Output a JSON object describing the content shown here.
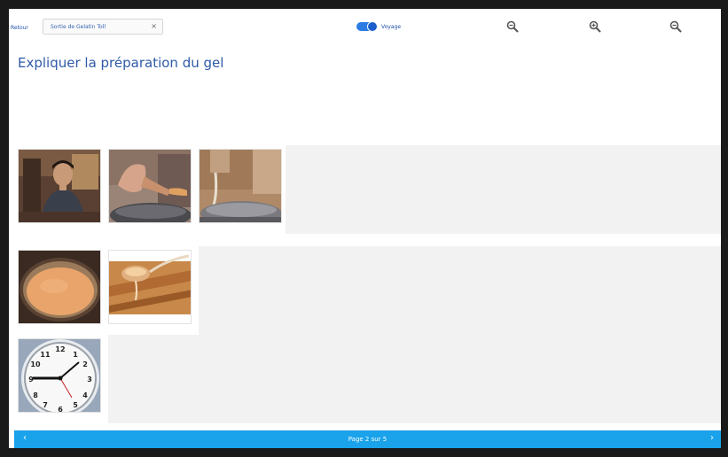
{
  "toolbar": {
    "back_label": "Retour",
    "tab_label": "Sortie de Gelatin Toll",
    "tab_close_glyph": "×",
    "toggle_label": "Voyage",
    "toggle_on": true,
    "zoom_icons": [
      "zoom-icon",
      "zoom-icon",
      "zoom-icon"
    ]
  },
  "page": {
    "title": "Expliquer la préparation du gel"
  },
  "steps": [
    {
      "images": [
        "man-in-kitchen-photo",
        "hand-pouring-photo",
        "pouring-liquid-photo"
      ]
    },
    {
      "images": [
        "gel-in-pot-photo",
        "ladle-pouring-photo"
      ]
    },
    {
      "images": [
        "wall-clock-photo"
      ]
    }
  ],
  "nav": {
    "prev_glyph": "‹",
    "next_glyph": "›",
    "page_indicator": "Page 2 sur 5"
  },
  "colors": {
    "accent": "#1aa3ea",
    "title": "#2f5aa8",
    "empty_slot": "#f2f2f2"
  }
}
